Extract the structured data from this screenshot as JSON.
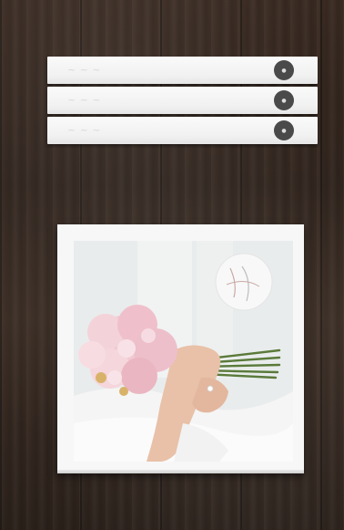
{
  "image": {
    "subject": "wedding-album-product-shot",
    "spines": [
      {
        "id": "spine-1",
        "badge_icon": "monogram-seal"
      },
      {
        "id": "spine-2",
        "badge_icon": "monogram-seal"
      },
      {
        "id": "spine-3",
        "badge_icon": "monogram-seal"
      }
    ],
    "album_cover": {
      "photo": "pink-bouquet-in-hands",
      "logo": "monogram-circle"
    },
    "colors": {
      "wood": "#2f231c",
      "album": "#f7f7f7",
      "bouquet_pink": "#efc3cc",
      "stems_green": "#5a7a3a",
      "badge": "#4a4a4a"
    }
  }
}
